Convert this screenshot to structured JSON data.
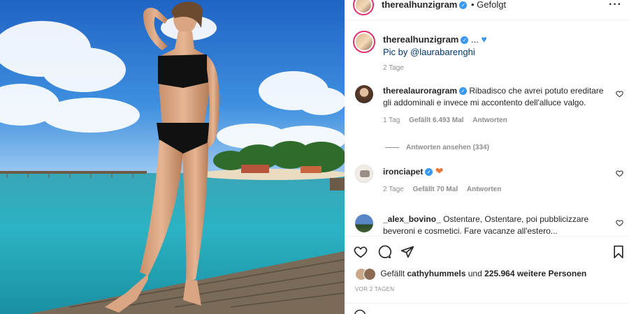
{
  "post": {
    "author": "therealhunzigram",
    "follow_state": "• Gefolgt",
    "caption_suffix": "...",
    "caption_line2": "Pic by @laurabarenghi",
    "age": "2 Tage",
    "more": "..."
  },
  "comments": [
    {
      "user": "therealauroragram",
      "text": "Ribadisco che avrei potuto ereditare gli addominali e invece mi accontento dell'alluce valgo.",
      "time": "1 Tag",
      "likes": "Gefällt 6.493 Mal",
      "reply": "Antworten",
      "view_replies": "Antworten ansehen (334)"
    },
    {
      "user": "ironciapet",
      "text": "",
      "time": "2 Tage",
      "likes": "Gefällt 70 Mal",
      "reply": "Antworten"
    },
    {
      "user": "_alex_bovino_",
      "text": "Ostentare, Ostentare, poi pubblicizzare beveroni e cosmetici. Fare vacanze all'estero..."
    }
  ],
  "likes_line": {
    "prefix": "Gefällt",
    "user": "cathyhummels",
    "mid": "und",
    "count": "225.964 weitere Personen"
  },
  "date": "VOR 2 TAGEN",
  "icons": {
    "like": "heart-icon",
    "comment": "comment-icon",
    "share": "paper-plane-icon",
    "save": "bookmark-icon",
    "more": "more-dots-icon",
    "verified": "verified-badge-icon"
  },
  "colors": {
    "verified": "#3897f0",
    "link": "#00376b",
    "muted": "#8e8e8e"
  }
}
